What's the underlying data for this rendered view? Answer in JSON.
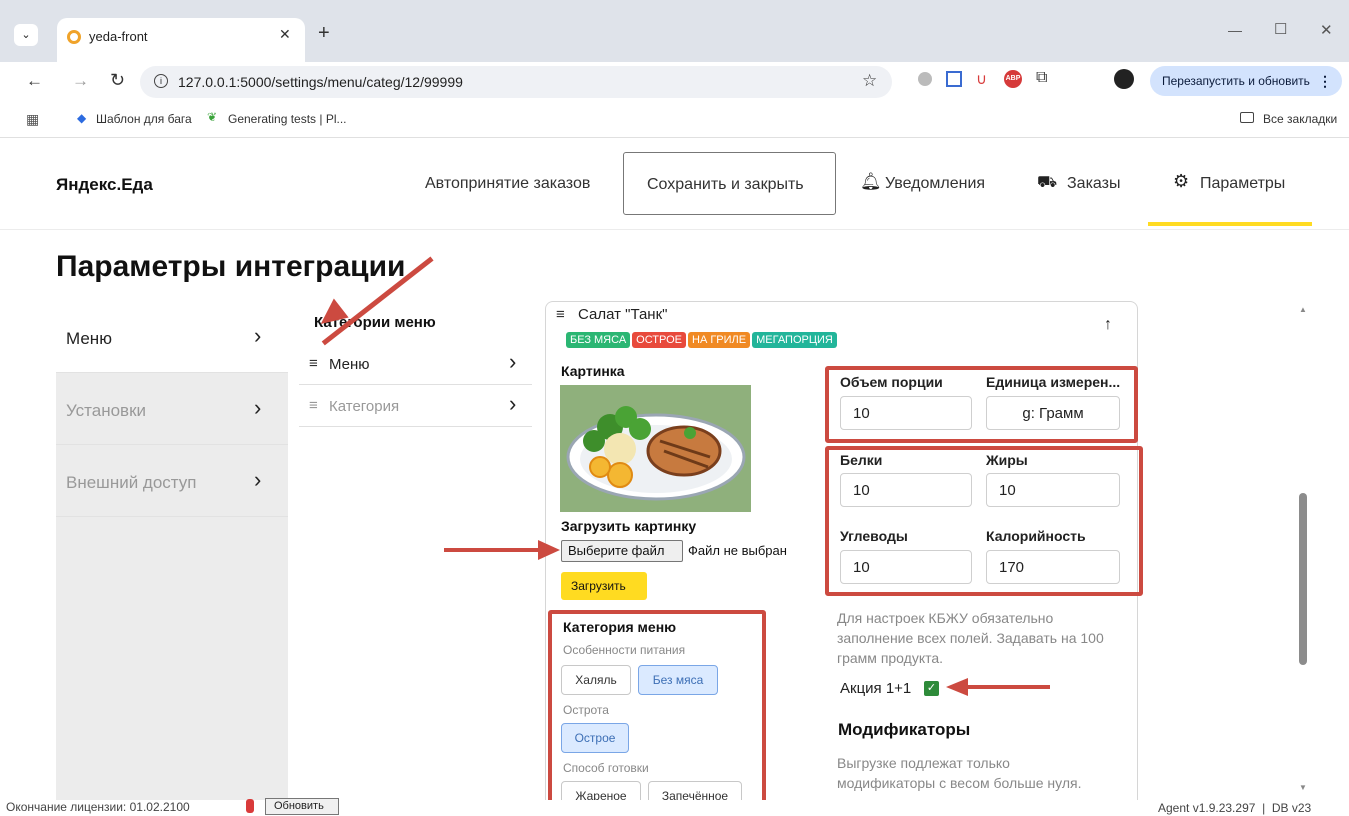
{
  "browser": {
    "tab_title": "yeda-front",
    "new_tab": "+",
    "url": "127.0.0.1:5000/settings/menu/categ/12/99999",
    "relaunch_button": "Перезапустить и обновить",
    "bookmarks": [
      "Шаблон для бага",
      "Generating tests | Pl..."
    ],
    "all_bookmarks": "Все закладки",
    "window_controls": [
      "—",
      "☐",
      "✕"
    ]
  },
  "header": {
    "logo": "Яндекс.Еда",
    "auto_accept": "Автопринятие заказов",
    "save_close": "Сохранить и закрыть",
    "notifications": "Уведомления",
    "orders": "Заказы",
    "parameters": "Параметры"
  },
  "page": {
    "title": "Параметры интеграции"
  },
  "sidebar": {
    "items": [
      {
        "label": "Меню"
      },
      {
        "label": "Установки"
      },
      {
        "label": "Внешний доступ"
      }
    ]
  },
  "categories": {
    "heading": "Категории меню",
    "items": [
      {
        "label": "Меню"
      },
      {
        "label": "Категория"
      }
    ]
  },
  "dish": {
    "title": "Салат \"Танк\"",
    "tags": [
      {
        "label": "БЕЗ МЯСА",
        "color": "#2bb673"
      },
      {
        "label": "ОСТРОЕ",
        "color": "#e84a3c"
      },
      {
        "label": "НА ГРИЛЕ",
        "color": "#f08a24"
      },
      {
        "label": "МЕГАПОРЦИЯ",
        "color": "#22b59a"
      }
    ],
    "picture_label": "Картинка",
    "upload_label": "Загрузить картинку",
    "choose_file": "Выберите файл",
    "no_file": "Файл не выбран",
    "upload_button": "Загрузить",
    "menu_category": {
      "heading": "Категория меню",
      "diet_label": "Особенности питания",
      "diet_options": [
        "Халяль",
        "Без мяса"
      ],
      "spice_label": "Острота",
      "spice_options": [
        "Острое"
      ],
      "cook_label": "Способ готовки",
      "cook_options": [
        "Жареное",
        "Запечённое"
      ]
    },
    "portion": {
      "volume_label": "Объем порции",
      "volume_value": "10",
      "unit_label": "Единица измерен...",
      "unit_value": "g: Грамм"
    },
    "nutrition": {
      "protein_label": "Белки",
      "protein_value": "10",
      "fat_label": "Жиры",
      "fat_value": "10",
      "carbs_label": "Углеводы",
      "carbs_value": "10",
      "calories_label": "Калорийность",
      "calories_value": "170",
      "note": "Для настроек КБЖУ обязательно заполнение всех полей. Задавать на 100 грамм продукта."
    },
    "promo_label": "Акция 1+1",
    "modifiers_heading": "Модификаторы",
    "modifiers_note": "Выгрузке подлежат только модификаторы с весом больше нуля."
  },
  "footer": {
    "license": "Окончание лицензии: 01.02.2100",
    "refresh": "Обновить",
    "version": "Agent v1.9.23.297  |  DB v23"
  },
  "colors": {
    "annotation_red": "#cc4a40",
    "accent_yellow": "#ffdb21"
  }
}
